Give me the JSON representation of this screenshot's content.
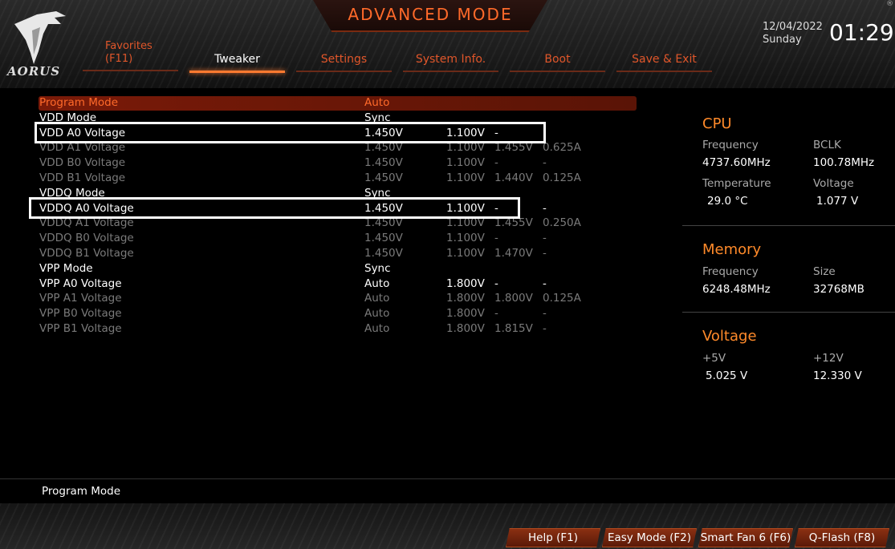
{
  "header": {
    "title": "ADVANCED MODE",
    "brand": "AORUS",
    "date": "12/04/2022",
    "day": "Sunday",
    "time": "01:29",
    "reg_mark": "®"
  },
  "tabs": [
    {
      "label_line1": "Favorites",
      "label_line2": "(F11)"
    },
    {
      "label": "Tweaker",
      "active": true
    },
    {
      "label": "Settings"
    },
    {
      "label": "System Info."
    },
    {
      "label": "Boot"
    },
    {
      "label": "Save & Exit"
    }
  ],
  "settings": [
    {
      "name": "Program Mode",
      "v1": "Auto",
      "v2": "",
      "v3": "",
      "v4": "",
      "state": "selected"
    },
    {
      "name": "VDD Mode",
      "v1": "Sync",
      "v2": "",
      "v3": "",
      "v4": "",
      "state": "normal"
    },
    {
      "name": "VDD A0 Voltage",
      "v1": "1.450V",
      "v2": "1.100V",
      "v3": "-",
      "v4": "",
      "state": "normal"
    },
    {
      "name": "VDD A1 Voltage",
      "v1": "1.450V",
      "v2": "1.100V",
      "v3": "1.455V",
      "v4": "0.625A",
      "state": "dim"
    },
    {
      "name": "VDD B0 Voltage",
      "v1": "1.450V",
      "v2": "1.100V",
      "v3": "-",
      "v4": "-",
      "state": "dim"
    },
    {
      "name": "VDD B1 Voltage",
      "v1": "1.450V",
      "v2": "1.100V",
      "v3": "1.440V",
      "v4": "0.125A",
      "state": "dim"
    },
    {
      "name": "VDDQ Mode",
      "v1": "Sync",
      "v2": "",
      "v3": "",
      "v4": "",
      "state": "normal"
    },
    {
      "name": "VDDQ A0 Voltage",
      "v1": "1.450V",
      "v2": "1.100V",
      "v3": "-",
      "v4": "-",
      "state": "normal"
    },
    {
      "name": "VDDQ A1 Voltage",
      "v1": "1.450V",
      "v2": "1.100V",
      "v3": "1.455V",
      "v4": "0.250A",
      "state": "dim"
    },
    {
      "name": "VDDQ B0 Voltage",
      "v1": "1.450V",
      "v2": "1.100V",
      "v3": "-",
      "v4": "-",
      "state": "dim"
    },
    {
      "name": "VDDQ B1 Voltage",
      "v1": "1.450V",
      "v2": "1.100V",
      "v3": "1.470V",
      "v4": "-",
      "state": "dim"
    },
    {
      "name": "VPP Mode",
      "v1": "Sync",
      "v2": "",
      "v3": "",
      "v4": "",
      "state": "normal"
    },
    {
      "name": "VPP A0 Voltage",
      "v1": "Auto",
      "v2": "1.800V",
      "v3": "-",
      "v4": "-",
      "state": "normal"
    },
    {
      "name": "VPP A1 Voltage",
      "v1": "Auto",
      "v2": "1.800V",
      "v3": "1.800V",
      "v4": "0.125A",
      "state": "dim"
    },
    {
      "name": "VPP B0 Voltage",
      "v1": "Auto",
      "v2": "1.800V",
      "v3": "-",
      "v4": "-",
      "state": "dim"
    },
    {
      "name": "VPP B1 Voltage",
      "v1": "Auto",
      "v2": "1.800V",
      "v3": "1.815V",
      "v4": "-",
      "state": "dim"
    }
  ],
  "cpu": {
    "title": "CPU",
    "freq_label": "Frequency",
    "freq": "4737.60MHz",
    "bclk_label": "BCLK",
    "bclk": "100.78MHz",
    "temp_label": "Temperature",
    "temp": "29.0 °C",
    "volt_label": "Voltage",
    "volt": "1.077 V"
  },
  "memory": {
    "title": "Memory",
    "freq_label": "Frequency",
    "freq": "6248.48MHz",
    "size_label": "Size",
    "size": "32768MB"
  },
  "voltage": {
    "title": "Voltage",
    "p5_label": "+5V",
    "p5": "5.025 V",
    "p12_label": "+12V",
    "p12": "12.330 V"
  },
  "help": {
    "text": "Program Mode"
  },
  "footer": {
    "help": "Help (F1)",
    "easy": "Easy Mode (F2)",
    "fan": "Smart Fan 6 (F6)",
    "qflash": "Q-Flash (F8)"
  },
  "colors": {
    "accent": "#ff6a2a",
    "selected_bg": "#7a1a08",
    "dim_text": "#7a7a7a"
  }
}
